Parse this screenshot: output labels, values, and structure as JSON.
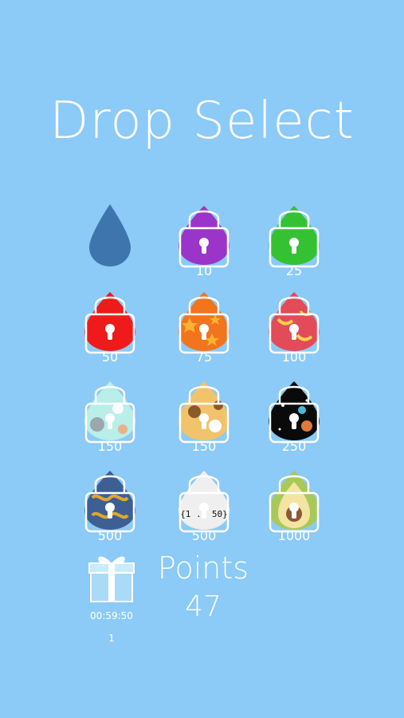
{
  "title": "Drop Select",
  "drops": [
    {
      "id": "blue",
      "price": "",
      "locked": false,
      "selected": true,
      "pattern": "plain-blue",
      "color": "#3f75ad"
    },
    {
      "id": "purple",
      "price": "10",
      "locked": true,
      "pattern": "plain",
      "color": "#9b34c9"
    },
    {
      "id": "green",
      "price": "25",
      "locked": true,
      "pattern": "plain",
      "color": "#35c232"
    },
    {
      "id": "red",
      "price": "50",
      "locked": true,
      "pattern": "plain",
      "color": "#ef1a1a"
    },
    {
      "id": "orange-stars",
      "price": "75",
      "locked": true,
      "pattern": "stars",
      "color": "#f2741d"
    },
    {
      "id": "bananas",
      "price": "100",
      "locked": true,
      "pattern": "bananas",
      "color": "#e24b58"
    },
    {
      "id": "cats",
      "price": "150",
      "locked": true,
      "pattern": "cats",
      "color": "#b9eee9"
    },
    {
      "id": "dogs",
      "price": "150",
      "locked": true,
      "pattern": "dogs",
      "color": "#f1c36b"
    },
    {
      "id": "space",
      "price": "250",
      "locked": true,
      "pattern": "space",
      "color": "#0a0a0a"
    },
    {
      "id": "infinity",
      "price": "500",
      "locked": true,
      "pattern": "infinity",
      "color": "#3d5f93"
    },
    {
      "id": "code",
      "price": "500",
      "locked": true,
      "pattern": "code",
      "color": "#efefef"
    },
    {
      "id": "avocado",
      "price": "1000",
      "locked": true,
      "pattern": "avocado",
      "color": "#a8c95a"
    }
  ],
  "gift": {
    "icon": "gift-icon",
    "timer": "00:59:50",
    "count": "1"
  },
  "points": {
    "label": "Points",
    "value": "47"
  },
  "colors": {
    "background": "#8ccaf7",
    "text": "#ffffff"
  }
}
